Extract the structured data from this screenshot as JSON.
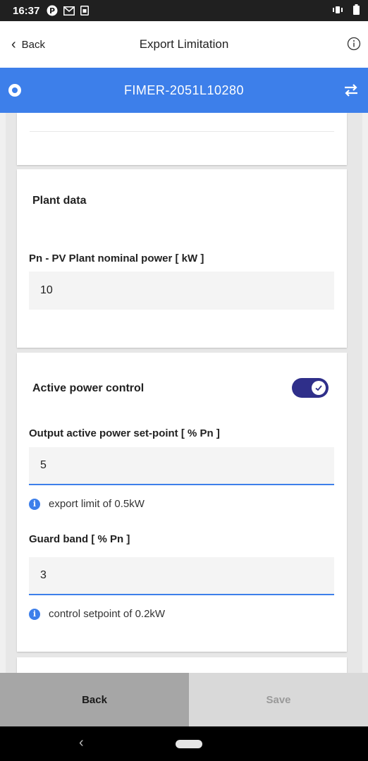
{
  "status_bar": {
    "time": "16:37",
    "icons": [
      "p-circle-icon",
      "gmail-icon",
      "sim-icon",
      "vibrate-icon",
      "battery-icon"
    ]
  },
  "header": {
    "back_label": "Back",
    "title": "Export Limitation",
    "info_icon": "info-circle-icon"
  },
  "device_bar": {
    "device_name": "FIMER-2051L10280",
    "color": "#3d7fea"
  },
  "plant_data": {
    "section_title": "Plant data",
    "nominal_power_label": "Pn - PV Plant nominal power [ kW ]",
    "nominal_power_value": "10"
  },
  "active_power": {
    "section_title": "Active power control",
    "enabled": true,
    "setpoint_label": "Output active power set-point [ % Pn ]",
    "setpoint_value": "5",
    "setpoint_hint": "export limit of 0.5kW",
    "guard_band_label": "Guard band [ % Pn ]",
    "guard_band_value": "3",
    "guard_band_hint": "control setpoint of 0.2kW"
  },
  "footer": {
    "back_label": "Back",
    "save_label": "Save"
  }
}
